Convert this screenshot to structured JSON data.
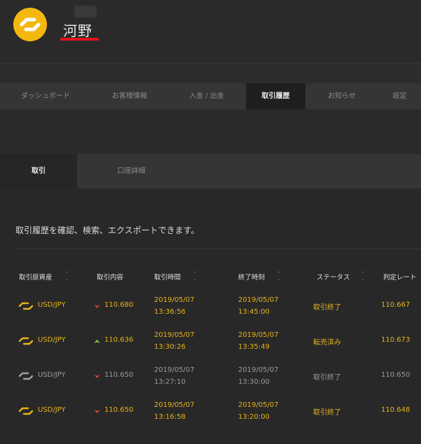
{
  "header": {
    "username": "河野"
  },
  "colors": {
    "accent": "#f3b70f",
    "gold_text": "#e8b21a",
    "underline": "#e0141a",
    "down": "#e2463a",
    "up": "#9ed63a",
    "inactive": "#9a9a9a"
  },
  "nav": {
    "tabs": [
      {
        "label": "ダッシュボード"
      },
      {
        "label": "お客様情報"
      },
      {
        "label": "入金 / 出金"
      },
      {
        "label": "取引履歴"
      },
      {
        "label": "お知らせ"
      },
      {
        "label": "設定"
      }
    ],
    "active": "取引履歴"
  },
  "subnav": {
    "tabs": [
      {
        "label": "取引"
      },
      {
        "label": "口座詳細"
      }
    ],
    "active": "取引"
  },
  "description": "取引履歴を確認、検索、エクスポートできます。",
  "table": {
    "columns": [
      {
        "label": "取引原資産",
        "sortable": true
      },
      {
        "label": "取引内容",
        "sortable": false
      },
      {
        "label": "取引時間",
        "sortable": true
      },
      {
        "label": "終了時刻",
        "sortable": true
      },
      {
        "label": "ステータス",
        "sortable": true
      },
      {
        "label": "判定レート",
        "sortable": false
      }
    ],
    "rows": [
      {
        "asset": "USD/JPY",
        "direction": "down",
        "rate": "110.680",
        "trade_date": "2019/05/07",
        "trade_time": "13:36:56",
        "end_date": "2019/05/07",
        "end_time": "13:45:00",
        "status": "取引終了",
        "judge_rate": "110.667",
        "highlight": true
      },
      {
        "asset": "USD/JPY",
        "direction": "up",
        "rate": "110.636",
        "trade_date": "2019/05/07",
        "trade_time": "13:30:26",
        "end_date": "2019/05/07",
        "end_time": "13:35:49",
        "status": "転売済み",
        "judge_rate": "110.673",
        "highlight": true
      },
      {
        "asset": "USD/JPY",
        "direction": "down",
        "rate": "110.650",
        "trade_date": "2019/05/07",
        "trade_time": "13:27:10",
        "end_date": "2019/05/07",
        "end_time": "13:30:00",
        "status": "取引終了",
        "judge_rate": "110.650",
        "highlight": false
      },
      {
        "asset": "USD/JPY",
        "direction": "down",
        "rate": "110.650",
        "trade_date": "2019/05/07",
        "trade_time": "13:16:58",
        "end_date": "2019/05/07",
        "end_time": "13:20:00",
        "status": "取引終了",
        "judge_rate": "110.648",
        "highlight": true
      }
    ]
  }
}
